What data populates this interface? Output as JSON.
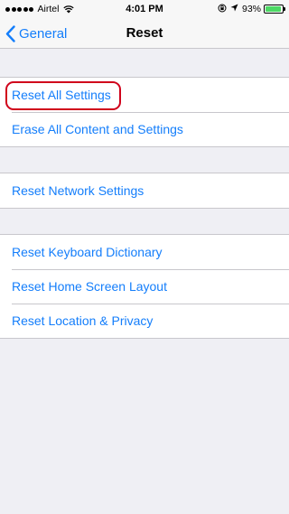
{
  "status_bar": {
    "carrier": "Airtel",
    "time": "4:01 PM",
    "battery_percent": "93%",
    "battery_level": 0.93,
    "battery_color": "#4cd964",
    "icons": [
      "signal-dots-icon",
      "wifi-icon",
      "rotation-lock-icon",
      "location-arrow-icon",
      "battery-icon"
    ]
  },
  "navbar": {
    "back_label": "General",
    "title": "Reset",
    "accent_color": "#147efb"
  },
  "groups": [
    {
      "items": [
        {
          "label": "Reset All Settings",
          "highlighted": true
        },
        {
          "label": "Erase All Content and Settings"
        }
      ]
    },
    {
      "items": [
        {
          "label": "Reset Network Settings"
        }
      ]
    },
    {
      "items": [
        {
          "label": "Reset Keyboard Dictionary"
        },
        {
          "label": "Reset Home Screen Layout"
        },
        {
          "label": "Reset Location & Privacy"
        }
      ]
    }
  ],
  "highlight_color": "#d0021b"
}
